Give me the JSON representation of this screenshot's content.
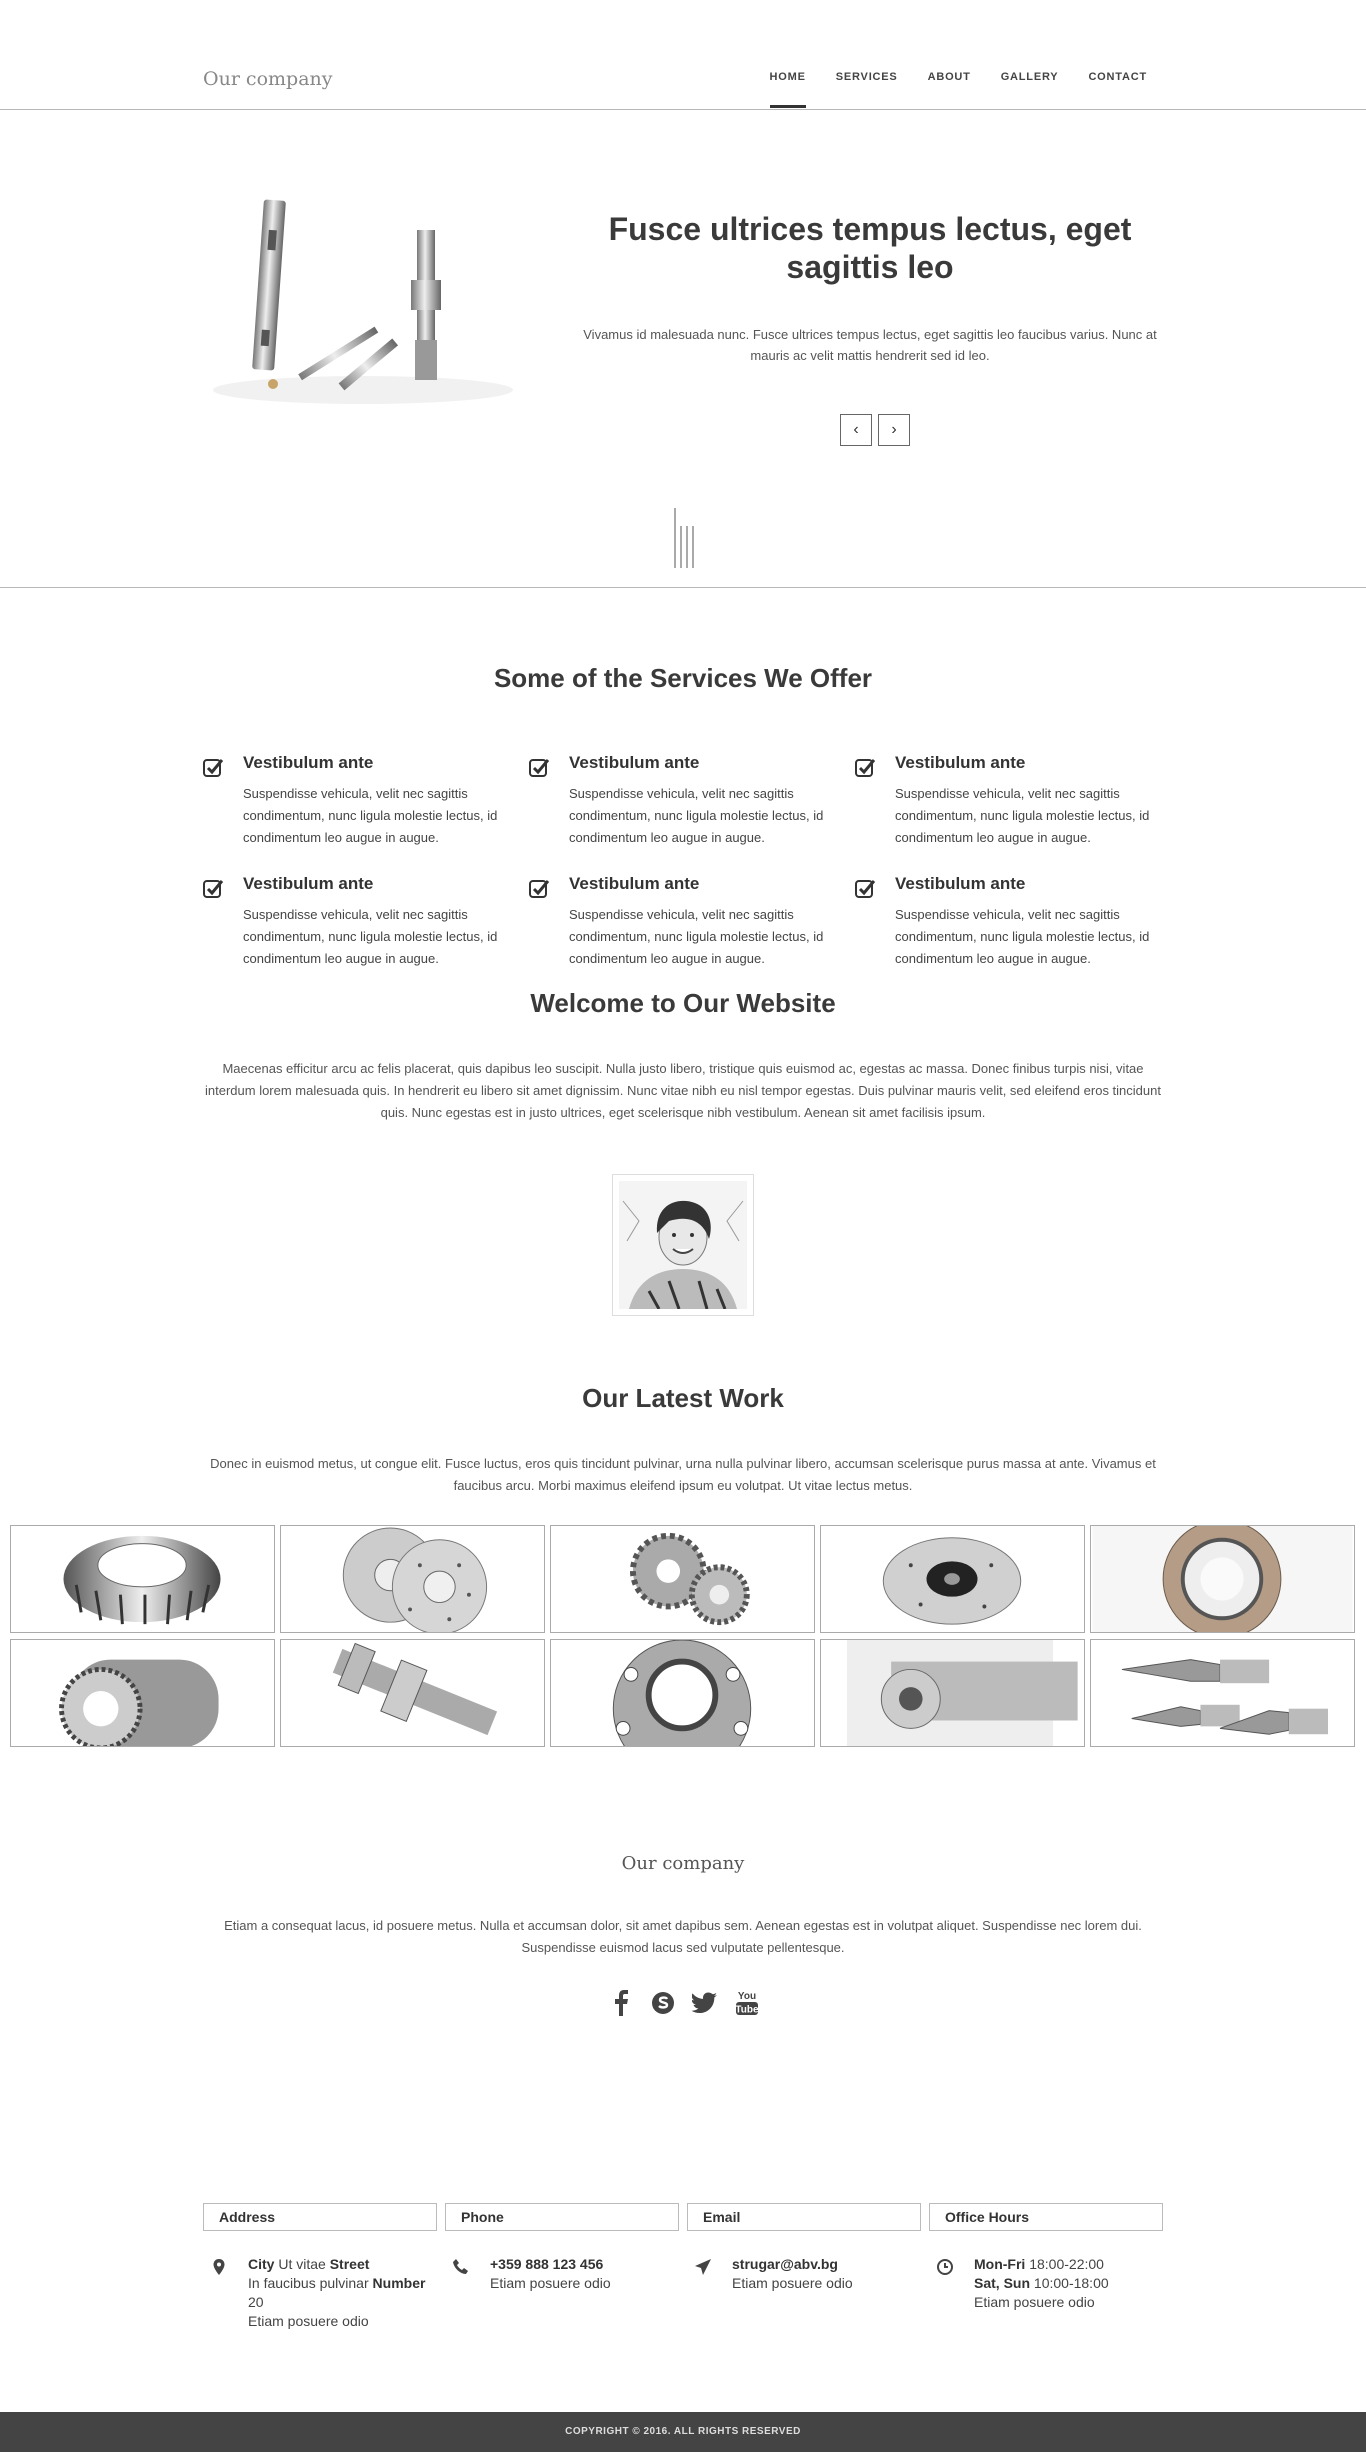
{
  "brand": "Our company",
  "nav": [
    "HOME",
    "SERVICES",
    "ABOUT",
    "GALLERY",
    "CONTACT"
  ],
  "hero": {
    "title": "Fusce ultrices tempus lectus, eget sagittis leo",
    "text": "Vivamus id malesuada nunc. Fusce ultrices tempus lectus, eget sagittis leo faucibus varius. Nunc at mauris ac velit mattis hendrerit sed id leo.",
    "prev": "‹",
    "next": "›"
  },
  "services": {
    "title": "Some of the Services We Offer",
    "items": [
      {
        "title": "Vestibulum ante",
        "text": "Suspendisse vehicula, velit nec sagittis condimentum, nunc ligula molestie lectus, id condimentum leo augue in augue."
      },
      {
        "title": "Vestibulum ante",
        "text": "Suspendisse vehicula, velit nec sagittis condimentum, nunc ligula molestie lectus, id condimentum leo augue in augue."
      },
      {
        "title": "Vestibulum ante",
        "text": "Suspendisse vehicula, velit nec sagittis condimentum, nunc ligula molestie lectus, id condimentum leo augue in augue."
      },
      {
        "title": "Vestibulum ante",
        "text": "Suspendisse vehicula, velit nec sagittis condimentum, nunc ligula molestie lectus, id condimentum leo augue in augue."
      },
      {
        "title": "Vestibulum ante",
        "text": "Suspendisse vehicula, velit nec sagittis condimentum, nunc ligula molestie lectus, id condimentum leo augue in augue."
      },
      {
        "title": "Vestibulum ante",
        "text": "Suspendisse vehicula, velit nec sagittis condimentum, nunc ligula molestie lectus, id condimentum leo augue in augue."
      }
    ]
  },
  "welcome": {
    "title": "Welcome to Our Website",
    "text": "Maecenas efficitur arcu ac felis placerat, quis dapibus leo suscipit. Nulla justo libero, tristique quis euismod ac, egestas ac massa. Donec finibus turpis nisi, vitae interdum lorem malesuada quis. In hendrerit eu libero sit amet dignissim. Nunc vitae nibh eu nisl tempor egestas. Duis pulvinar mauris velit, sed eleifend eros tincidunt quis. Nunc egestas est in justo ultrices, eget scelerisque nibh vestibulum. Aenean sit amet facilisis ipsum."
  },
  "work": {
    "title": "Our Latest Work",
    "text": "Donec in euismod metus, ut congue elit. Fusce luctus, eros quis tincidunt pulvinar, urna nulla pulvinar libero, accumsan scelerisque purus massa at ante. Vivamus et faucibus arcu. Morbi maximus eleifend ipsum eu volutpat. Ut vitae lectus metus."
  },
  "footer": {
    "name": "Our company",
    "text": "Etiam a consequat lacus, id posuere metus. Nulla et accumsan dolor, sit amet dapibus sem. Aenean egestas est in volutpat aliquet. Suspendisse nec lorem dui. Suspendisse euismod lacus sed vulputate pellentesque.",
    "social": [
      "facebook-icon",
      "skype-icon",
      "twitter-icon",
      "youtube-icon"
    ],
    "youtube_text": "You Tube"
  },
  "contact": {
    "address": {
      "head": "Address",
      "city_label": "City",
      "city_rest": " Ut vitae ",
      "street": "Street",
      "line2": "In faucibus pulvinar ",
      "number": "Number",
      "line3": "20",
      "line4": "Etiam posuere odio"
    },
    "phone": {
      "head": "Phone",
      "number": "+359 888 123 456",
      "sub": "Etiam posuere odio"
    },
    "email": {
      "head": "Email",
      "addr": "strugar@abv.bg",
      "sub": "Etiam posuere odio"
    },
    "hours": {
      "head": "Office Hours",
      "d1": "Mon-Fri",
      "t1": " 18:00-22:00",
      "d2": "Sat, Sun",
      "t2": " 10:00-18:00",
      "sub": "Etiam posuere odio"
    }
  },
  "copyright": "COPYRIGHT © 2016. ALL RIGHTS RESERVED"
}
